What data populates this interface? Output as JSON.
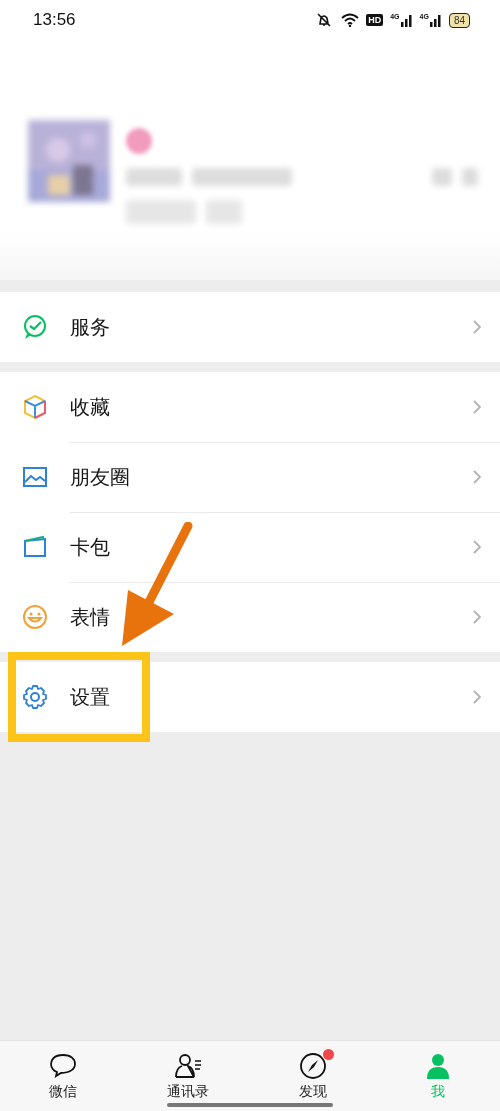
{
  "status_bar": {
    "time": "13:56",
    "hd": "HD",
    "networks": [
      "4G",
      "4G"
    ],
    "battery": "84"
  },
  "menu_groups": [
    {
      "items": [
        {
          "label": "服务"
        }
      ]
    },
    {
      "items": [
        {
          "label": "收藏"
        },
        {
          "label": "朋友圈"
        },
        {
          "label": "卡包"
        },
        {
          "label": "表情"
        }
      ]
    },
    {
      "items": [
        {
          "label": "设置"
        }
      ]
    }
  ],
  "tab_bar": [
    {
      "label": "微信",
      "selected": false,
      "badge": false
    },
    {
      "label": "通讯录",
      "selected": false,
      "badge": false
    },
    {
      "label": "发现",
      "selected": false,
      "badge": true
    },
    {
      "label": "我",
      "selected": true,
      "badge": false
    }
  ]
}
